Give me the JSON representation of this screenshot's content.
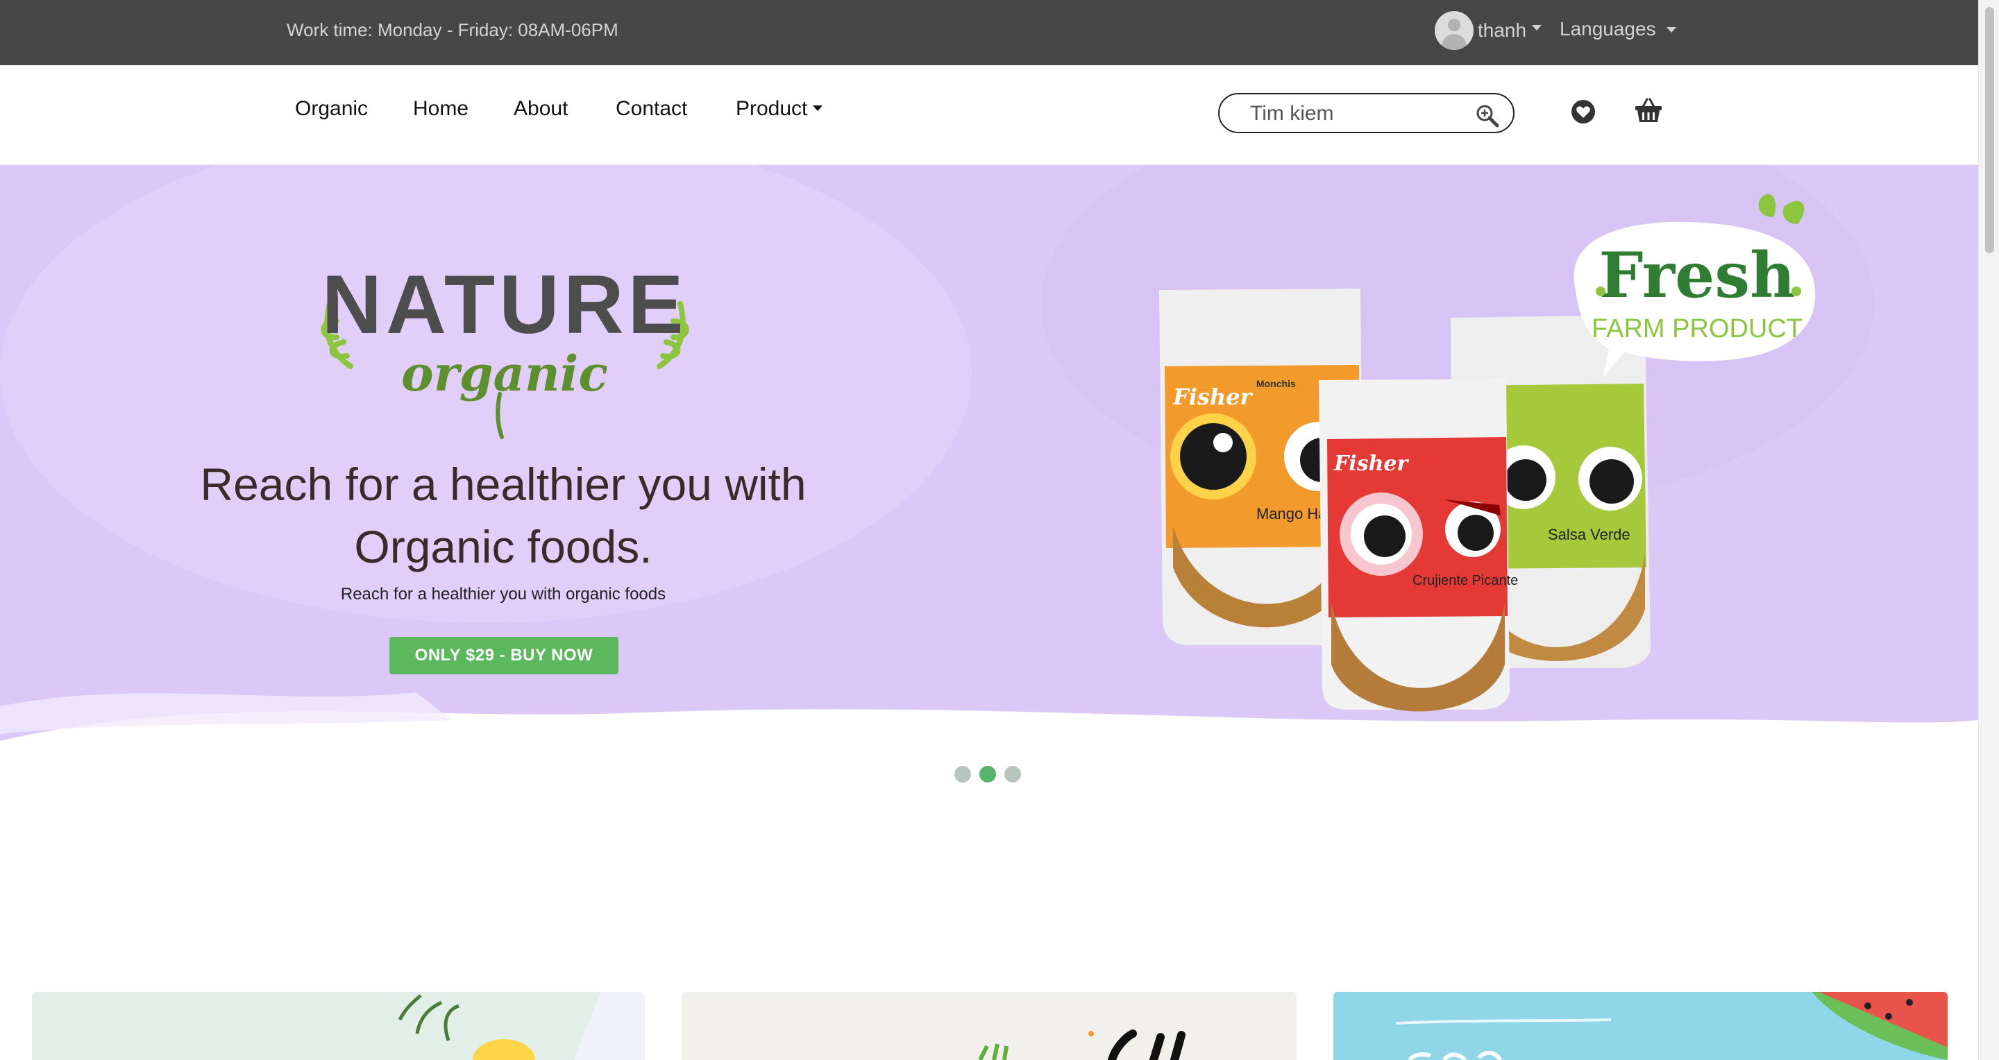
{
  "topbar": {
    "work_time": "Work time: Monday - Friday: 08AM-06PM",
    "username": "thanh",
    "languages_label": "Languages"
  },
  "nav": {
    "items": [
      "Organic",
      "Home",
      "About",
      "Contact",
      "Product"
    ],
    "search_placeholder": "Tim kiem"
  },
  "hero": {
    "logo_text_top": "NATURE",
    "logo_text_bottom": "organic",
    "headline_line1": "Reach for a healthier you with",
    "headline_line2": "Organic foods.",
    "subline": "Reach for a healthier you with organic foods",
    "button_label": "ONLY $29 - BUY NOW",
    "badge_title": "Fresh",
    "badge_subtitle": "FARM PRODUCT",
    "product_brand": "Fisher",
    "product_line": "Monchis",
    "products": [
      "Mango Habanero",
      "Crujiente Picante",
      "Salsa Verde"
    ],
    "slides_total": 3,
    "active_slide": 2
  },
  "colors": {
    "topbar_bg": "#474747",
    "hero_bg": "#dcc8f7",
    "accent_green": "#5cb85c",
    "text_dark": "#3b2a2a"
  },
  "icons": [
    "avatar-icon",
    "search-icon",
    "heart-icon",
    "cart-basket-icon"
  ]
}
